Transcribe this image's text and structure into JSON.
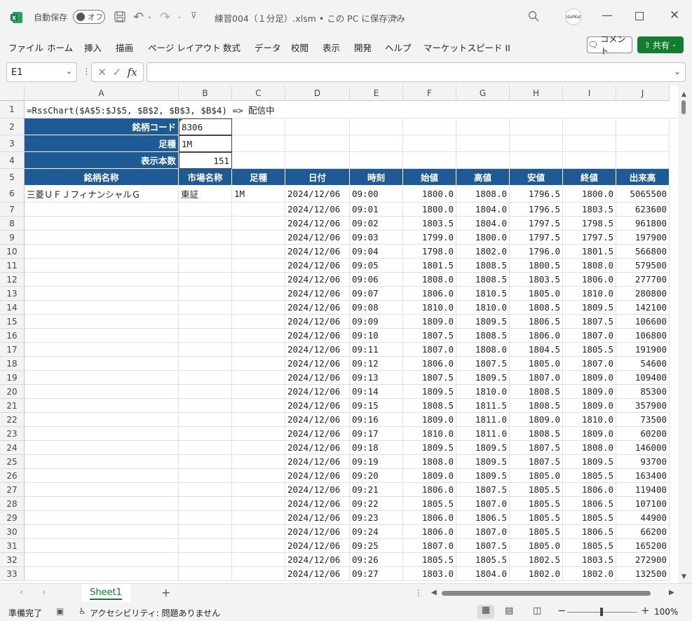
{
  "title": {
    "autosave_label": "自動保存",
    "autosave_state": "オフ",
    "doc_title": "練習004（１分足）.xlsm • この PC に保存済み",
    "avatar_text": "totalMath"
  },
  "menu": [
    "ファイル",
    "ホーム",
    "挿入",
    "描画",
    "ページ レイアウト",
    "数式",
    "データ",
    "校閲",
    "表示",
    "開発",
    "ヘルプ",
    "マーケットスピード II"
  ],
  "comment_label": "コメント",
  "share_label": "共有",
  "namebox_value": "E1",
  "formula_value": "",
  "columns": [
    "A",
    "B",
    "C",
    "D",
    "E",
    "F",
    "G",
    "H",
    "I",
    "J"
  ],
  "row1_formula": "=RssChart($A$5:$J$5, $B$2, $B$3, $B$4) => 配信中",
  "params": [
    {
      "label": "銘柄コード",
      "value": "8306"
    },
    {
      "label": "足種",
      "value": "1M"
    },
    {
      "label": "表示本数",
      "value": "151"
    }
  ],
  "table_headers": [
    "銘柄名称",
    "市場名称",
    "足種",
    "日付",
    "時刻",
    "始値",
    "高値",
    "安値",
    "終値",
    "出来高"
  ],
  "first_row_meta": {
    "name": "三菱ＵＦＪフィナンシャルＧ",
    "market": "東証",
    "bar": "1M"
  },
  "rows": [
    [
      "2024/12/06",
      "09:00",
      "1800.0",
      "1808.0",
      "1796.5",
      "1800.0",
      "5065500"
    ],
    [
      "2024/12/06",
      "09:01",
      "1800.0",
      "1804.0",
      "1796.5",
      "1803.5",
      "623600"
    ],
    [
      "2024/12/06",
      "09:02",
      "1803.5",
      "1804.0",
      "1797.5",
      "1798.5",
      "961800"
    ],
    [
      "2024/12/06",
      "09:03",
      "1799.0",
      "1800.0",
      "1797.5",
      "1797.5",
      "197900"
    ],
    [
      "2024/12/06",
      "09:04",
      "1798.0",
      "1802.0",
      "1796.0",
      "1801.5",
      "566800"
    ],
    [
      "2024/12/06",
      "09:05",
      "1801.5",
      "1808.5",
      "1800.5",
      "1808.0",
      "579500"
    ],
    [
      "2024/12/06",
      "09:06",
      "1808.0",
      "1808.5",
      "1803.5",
      "1806.0",
      "277700"
    ],
    [
      "2024/12/06",
      "09:07",
      "1806.0",
      "1810.5",
      "1805.0",
      "1810.0",
      "280800"
    ],
    [
      "2024/12/06",
      "09:08",
      "1810.0",
      "1810.0",
      "1808.5",
      "1809.5",
      "142100"
    ],
    [
      "2024/12/06",
      "09:09",
      "1809.0",
      "1809.5",
      "1806.5",
      "1807.5",
      "106600"
    ],
    [
      "2024/12/06",
      "09:10",
      "1807.5",
      "1808.5",
      "1806.0",
      "1807.0",
      "106800"
    ],
    [
      "2024/12/06",
      "09:11",
      "1807.0",
      "1808.0",
      "1804.5",
      "1805.5",
      "191900"
    ],
    [
      "2024/12/06",
      "09:12",
      "1806.0",
      "1807.5",
      "1805.0",
      "1807.0",
      "54600"
    ],
    [
      "2024/12/06",
      "09:13",
      "1807.5",
      "1809.5",
      "1807.0",
      "1809.0",
      "109400"
    ],
    [
      "2024/12/06",
      "09:14",
      "1809.5",
      "1810.0",
      "1808.5",
      "1809.0",
      "85300"
    ],
    [
      "2024/12/06",
      "09:15",
      "1808.5",
      "1811.5",
      "1808.5",
      "1809.0",
      "357900"
    ],
    [
      "2024/12/06",
      "09:16",
      "1809.0",
      "1811.0",
      "1809.0",
      "1810.0",
      "73500"
    ],
    [
      "2024/12/06",
      "09:17",
      "1810.0",
      "1811.0",
      "1808.5",
      "1809.0",
      "60200"
    ],
    [
      "2024/12/06",
      "09:18",
      "1809.5",
      "1809.5",
      "1807.5",
      "1808.0",
      "146000"
    ],
    [
      "2024/12/06",
      "09:19",
      "1808.0",
      "1809.5",
      "1807.5",
      "1809.5",
      "93700"
    ],
    [
      "2024/12/06",
      "09:20",
      "1809.0",
      "1809.5",
      "1805.0",
      "1805.5",
      "163400"
    ],
    [
      "2024/12/06",
      "09:21",
      "1806.0",
      "1807.5",
      "1805.5",
      "1806.0",
      "119400"
    ],
    [
      "2024/12/06",
      "09:22",
      "1805.5",
      "1807.0",
      "1805.5",
      "1806.5",
      "107100"
    ],
    [
      "2024/12/06",
      "09:23",
      "1806.0",
      "1806.5",
      "1805.5",
      "1805.5",
      "44900"
    ],
    [
      "2024/12/06",
      "09:24",
      "1806.0",
      "1807.0",
      "1805.5",
      "1806.5",
      "66200"
    ],
    [
      "2024/12/06",
      "09:25",
      "1807.0",
      "1807.5",
      "1805.0",
      "1805.5",
      "165200"
    ],
    [
      "2024/12/06",
      "09:26",
      "1805.5",
      "1805.5",
      "1802.5",
      "1803.5",
      "272900"
    ],
    [
      "2024/12/06",
      "09:27",
      "1803.0",
      "1804.0",
      "1802.0",
      "1802.0",
      "132500"
    ]
  ],
  "sheet_tab": "Sheet1",
  "status": {
    "ready": "準備完了",
    "accessibility": "アクセシビリティ: 問題ありません",
    "zoom": "100%"
  }
}
